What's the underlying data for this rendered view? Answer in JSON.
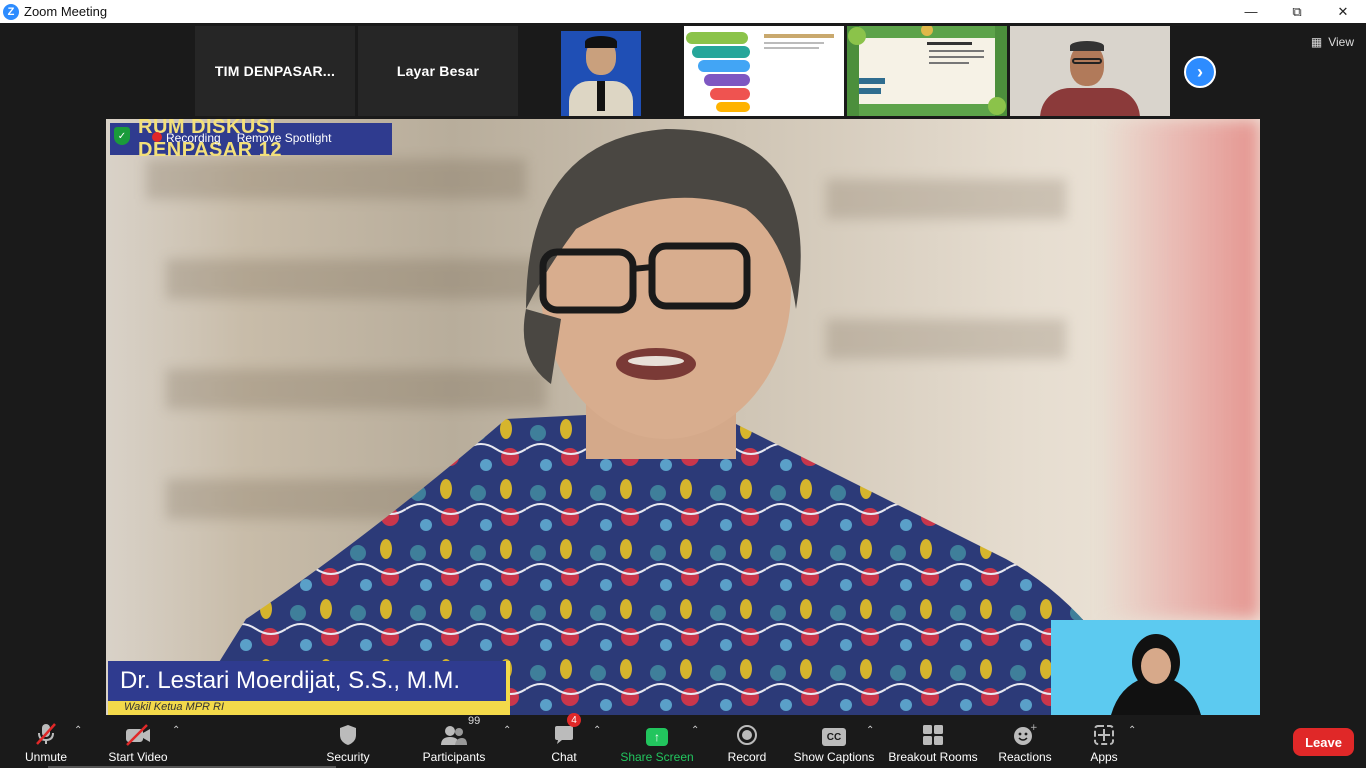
{
  "window": {
    "title": "Zoom Meeting",
    "controls": [
      "minimize",
      "restore",
      "close"
    ]
  },
  "strip": {
    "tiles": [
      {
        "name": "TIM  DENPASAR..."
      },
      {
        "name": "Layar Besar"
      }
    ],
    "view_label": "View"
  },
  "main": {
    "banner": "RUM DISKUSI DENPASAR 12",
    "overlay": {
      "record_label": "Recording",
      "spotlight_label": "Remove Spotlight"
    },
    "speaker_name": "Dr. Lestari Moerdijat, S.S., M.M.",
    "speaker_subtitle": "Wakil Ketua MPR RI"
  },
  "toolbar": {
    "unmute": "Unmute",
    "start_video": "Start Video",
    "security": "Security",
    "participants": "Participants",
    "participants_count": "99",
    "chat": "Chat",
    "chat_badge": "4",
    "share_screen": "Share Screen",
    "record": "Record",
    "show_captions": "Show Captions",
    "breakout_rooms": "Breakout Rooms",
    "reactions": "Reactions",
    "apps": "Apps",
    "leave": "Leave"
  },
  "colors": {
    "accent": "#2d8cff",
    "share_green": "#22c55e",
    "leave_red": "#e02828",
    "banner_blue": "#2f3b8f",
    "banner_yellow": "#f3e07a"
  }
}
